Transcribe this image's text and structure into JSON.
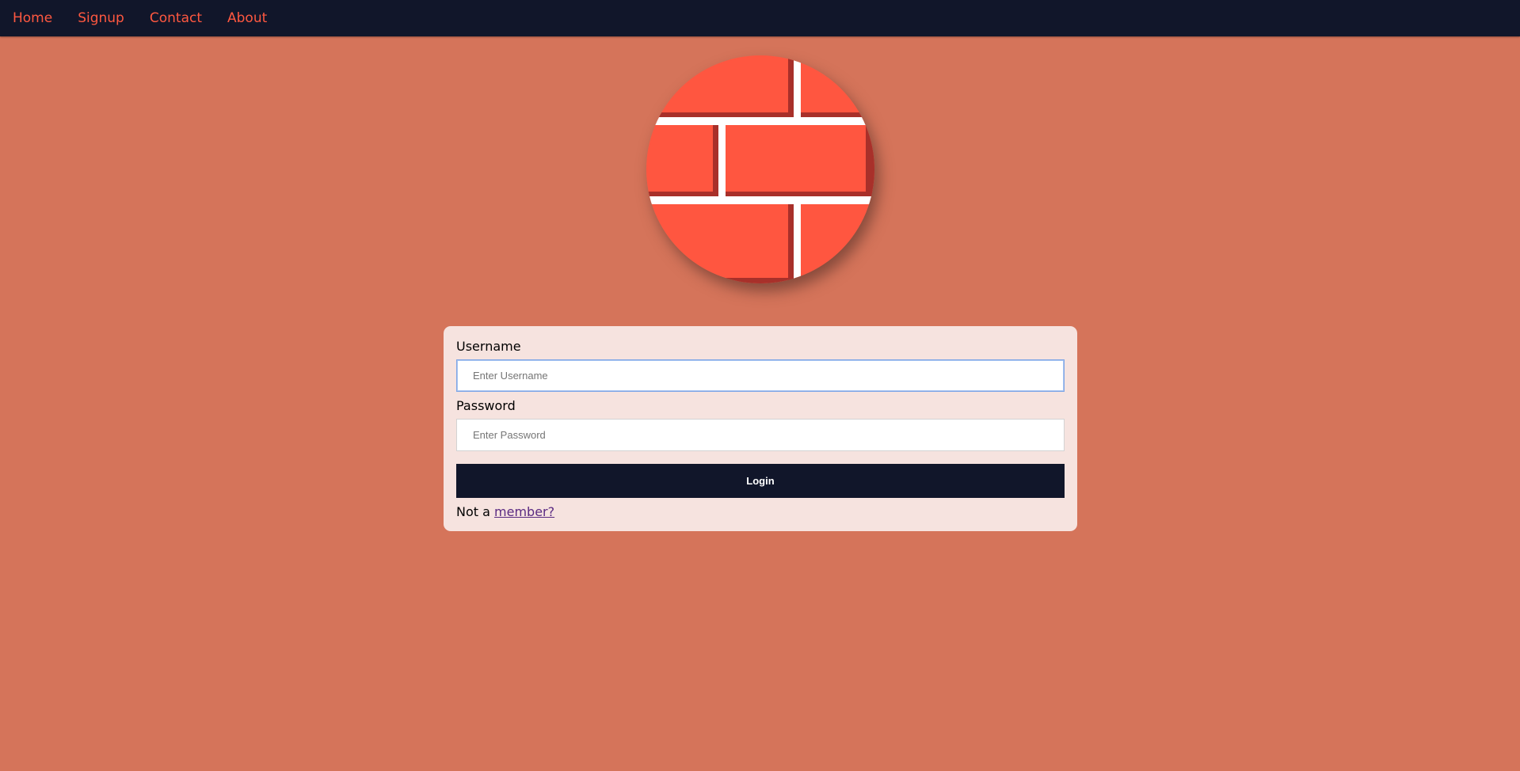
{
  "nav": {
    "items": [
      {
        "label": "Home"
      },
      {
        "label": "Signup"
      },
      {
        "label": "Contact"
      },
      {
        "label": "About"
      }
    ],
    "link_color": "#ff5840",
    "background": "#11162a"
  },
  "logo": {
    "icon": "brick-wall-icon",
    "brick_color": "#ff5640",
    "mortar_color": "#ffffff",
    "shadow_color": "#a8302a"
  },
  "login_form": {
    "username_label": "Username",
    "username_placeholder": "Enter Username",
    "username_value": "",
    "password_label": "Password",
    "password_placeholder": "Enter Password",
    "password_value": "",
    "login_label": "Login",
    "signup_prefix": "Not a",
    "signup_link": "member?"
  },
  "colors": {
    "page_background": "#d5745a",
    "card_background": "#f6e3df",
    "button_background": "#11162a"
  }
}
